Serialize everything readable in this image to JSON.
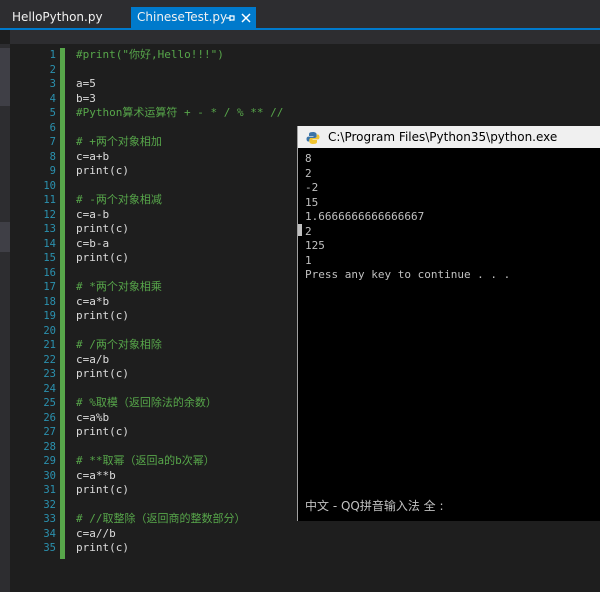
{
  "tabs": [
    {
      "label": "HelloPython.py",
      "active": false
    },
    {
      "label": "ChineseTest.py",
      "active": true,
      "pin_icon": "pin-icon",
      "close_icon": "close-icon"
    }
  ],
  "editor": {
    "lines": [
      {
        "n": "1",
        "text": "#print(\"你好,Hello!!!\")",
        "kind": "comment"
      },
      {
        "n": "2",
        "text": "",
        "kind": "code"
      },
      {
        "n": "3",
        "text": "a=5",
        "kind": "code"
      },
      {
        "n": "4",
        "text": "b=3",
        "kind": "code"
      },
      {
        "n": "5",
        "text": "#Python算术运算符 + - * / % ** //",
        "kind": "comment"
      },
      {
        "n": "6",
        "text": "",
        "kind": "code"
      },
      {
        "n": "7",
        "text": "# +两个对象相加",
        "kind": "comment"
      },
      {
        "n": "8",
        "text": "c=a+b",
        "kind": "code"
      },
      {
        "n": "9",
        "text": "print(c)",
        "kind": "code"
      },
      {
        "n": "10",
        "text": "",
        "kind": "code"
      },
      {
        "n": "11",
        "text": "# -两个对象相减",
        "kind": "comment"
      },
      {
        "n": "12",
        "text": "c=a-b",
        "kind": "code"
      },
      {
        "n": "13",
        "text": "print(c)",
        "kind": "code"
      },
      {
        "n": "14",
        "text": "c=b-a",
        "kind": "code"
      },
      {
        "n": "15",
        "text": "print(c)",
        "kind": "code"
      },
      {
        "n": "16",
        "text": "",
        "kind": "code"
      },
      {
        "n": "17",
        "text": "# *两个对象相乘",
        "kind": "comment"
      },
      {
        "n": "18",
        "text": "c=a*b",
        "kind": "code"
      },
      {
        "n": "19",
        "text": "print(c)",
        "kind": "code"
      },
      {
        "n": "20",
        "text": "",
        "kind": "code"
      },
      {
        "n": "21",
        "text": "# /两个对象相除",
        "kind": "comment"
      },
      {
        "n": "22",
        "text": "c=a/b",
        "kind": "code"
      },
      {
        "n": "23",
        "text": "print(c)",
        "kind": "code"
      },
      {
        "n": "24",
        "text": "",
        "kind": "code"
      },
      {
        "n": "25",
        "text": "# %取模（返回除法的余数）",
        "kind": "comment"
      },
      {
        "n": "26",
        "text": "c=a%b",
        "kind": "code"
      },
      {
        "n": "27",
        "text": "print(c)",
        "kind": "code"
      },
      {
        "n": "28",
        "text": "",
        "kind": "code"
      },
      {
        "n": "29",
        "text": "# **取幂（返回a的b次幂）",
        "kind": "comment"
      },
      {
        "n": "30",
        "text": "c=a**b",
        "kind": "code"
      },
      {
        "n": "31",
        "text": "print(c)",
        "kind": "code"
      },
      {
        "n": "32",
        "text": "",
        "kind": "code"
      },
      {
        "n": "33",
        "text": "# //取整除（返回商的整数部分）",
        "kind": "comment"
      },
      {
        "n": "34",
        "text": "c=a//b",
        "kind": "code"
      },
      {
        "n": "35",
        "text": "print(c)",
        "kind": "code"
      }
    ]
  },
  "console": {
    "title": "C:\\Program Files\\Python35\\python.exe",
    "icon": "python-icon",
    "output": [
      "8",
      "2",
      "-2",
      "15",
      "1.6666666666666667",
      "2",
      "125",
      "1",
      "Press any key to continue . . ."
    ],
    "ime_status": "中文 - QQ拼音输入法 全 :"
  },
  "colors": {
    "accent": "#007acc",
    "comment": "#57a64a",
    "line_number": "#2b91af",
    "code_text": "#dcdcdc",
    "console_text": "#c0c0c0"
  }
}
